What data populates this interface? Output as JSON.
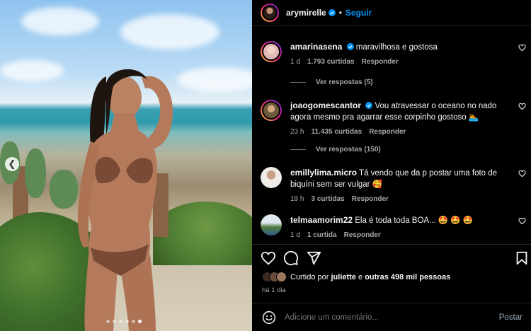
{
  "post": {
    "author": "arymirelle",
    "separator": "•",
    "follow_label": "Seguir"
  },
  "comments": [
    {
      "username": "amarinasena",
      "verified": true,
      "text": "maravilhosa e gostosa",
      "time": "1 d",
      "likes": "1.793 curtidas",
      "reply_label": "Responder",
      "replies_label": "Ver respostas (5)"
    },
    {
      "username": "joaogomescantor",
      "verified": true,
      "text": "Vou atravessar o oceano no nado agora mesmo pra agarrar esse corpinho gostoso 🏊",
      "time": "23 h",
      "likes": "11.435 curtidas",
      "reply_label": "Responder",
      "replies_label": "Ver respostas (150)"
    },
    {
      "username": "emillylima.micro",
      "verified": false,
      "text": "Tá vendo que da p postar uma foto de biquíni sem ser vulgar 🥰",
      "time": "19 h",
      "likes": "3 curtidas",
      "reply_label": "Responder"
    },
    {
      "username": "telmaamorim22",
      "verified": false,
      "text": "Ela é toda toda BOA... 🤩 🤩 🤩",
      "time": "1 d",
      "likes": "1 curtida",
      "reply_label": "Responder"
    }
  ],
  "likes_line": {
    "prefix": "Curtido por",
    "user": "juliette",
    "conj": "e",
    "others": "outras 498 mil pessoas"
  },
  "time_ago": "há 1 dia",
  "add_comment": {
    "placeholder": "Adicione um comentário...",
    "post_label": "Postar"
  },
  "carousel": {
    "total_dots": 6,
    "active_index": 5
  },
  "icons": {
    "verified": "verified-badge-icon",
    "heart": "heart-icon",
    "comment": "comment-icon",
    "share": "share-icon",
    "save": "bookmark-icon",
    "emoji": "emoji-icon",
    "prev": "chevron-left-icon"
  },
  "colors": {
    "accent": "#0095f6",
    "muted": "#a8a8a8",
    "background": "#000000"
  }
}
